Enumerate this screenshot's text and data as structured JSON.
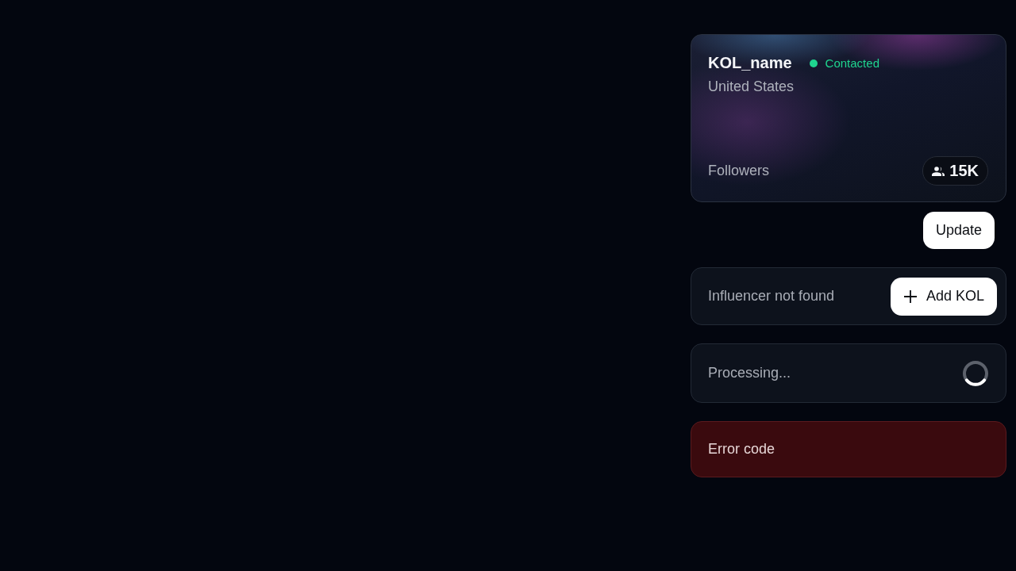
{
  "kol_card": {
    "name": "KOL_name",
    "status": {
      "label": "Contacted",
      "color": "#1fd58f"
    },
    "country": "United States",
    "followers_label": "Followers",
    "followers_count": "15K"
  },
  "update_button": "Update",
  "states": [
    {
      "kind": "not_found",
      "message": "Influencer not found",
      "button": "Add KOL"
    },
    {
      "kind": "loading",
      "message": "Processing..."
    },
    {
      "kind": "error",
      "message": "Error code"
    }
  ]
}
